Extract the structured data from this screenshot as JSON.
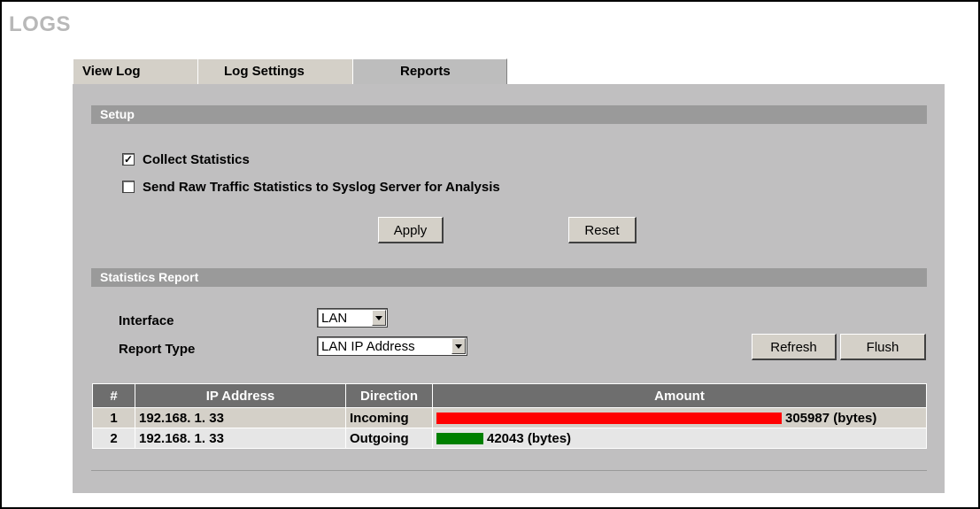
{
  "page": {
    "title": "LOGS"
  },
  "tabs": [
    {
      "label": "View Log"
    },
    {
      "label": "Log Settings"
    },
    {
      "label": "Reports"
    }
  ],
  "setup": {
    "heading": "Setup",
    "collect_statistics": {
      "label": "Collect Statistics",
      "checked": true
    },
    "send_raw": {
      "label": "Send Raw Traffic Statistics to Syslog Server for Analysis",
      "checked": false
    },
    "apply_label": "Apply",
    "reset_label": "Reset"
  },
  "report": {
    "heading": "Statistics Report",
    "interface_label": "Interface",
    "interface_value": "LAN",
    "report_type_label": "Report Type",
    "report_type_value": "LAN IP Address",
    "refresh_label": "Refresh",
    "flush_label": "Flush",
    "columns": [
      "#",
      "IP Address",
      "Direction",
      "Amount"
    ],
    "rows": [
      {
        "num": "1",
        "ip": "192.168. 1. 33",
        "direction": "Incoming",
        "amount": "305987 (bytes)",
        "bar_fraction": 1.0,
        "bar_color": "#ff0000"
      },
      {
        "num": "2",
        "ip": "192.168. 1. 33",
        "direction": "Outgoing",
        "amount": "42043 (bytes)",
        "bar_fraction": 0.137,
        "bar_color": "#008000"
      }
    ]
  }
}
